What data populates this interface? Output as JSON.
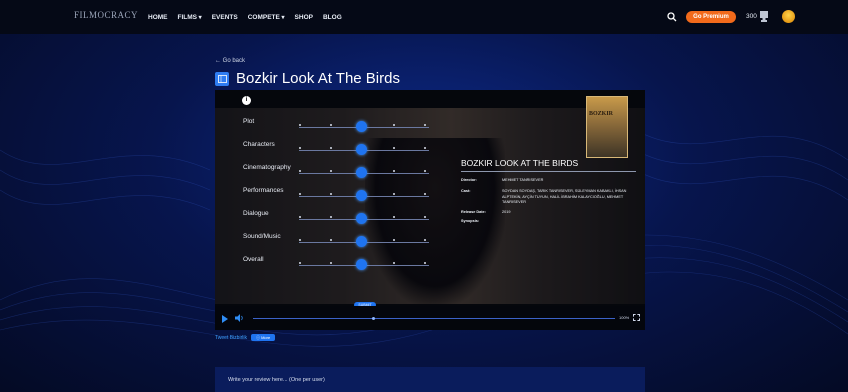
{
  "nav": {
    "logo": "FILMOCRACY",
    "items": [
      {
        "label": "HOME",
        "caret": false
      },
      {
        "label": "FILMS",
        "caret": true
      },
      {
        "label": "EVENTS",
        "caret": false
      },
      {
        "label": "COMPETE",
        "caret": true
      },
      {
        "label": "SHOP",
        "caret": false
      },
      {
        "label": "BLOG",
        "caret": false
      }
    ],
    "premium_label": "Go Premium",
    "coins": "300"
  },
  "header": {
    "back_label": "← Go back",
    "title": "Bozkir Look At The Birds"
  },
  "ratings": {
    "rows": [
      {
        "label": "Plot",
        "value": 3
      },
      {
        "label": "Characters",
        "value": 3
      },
      {
        "label": "Cinematography",
        "value": 3
      },
      {
        "label": "Performances",
        "value": 3
      },
      {
        "label": "Dialogue",
        "value": 3
      },
      {
        "label": "Sound/Music",
        "value": 3
      },
      {
        "label": "Overall",
        "value": 3
      }
    ],
    "scale_max": 5,
    "submit_label": "SUBMIT"
  },
  "film": {
    "poster_text": "BOZKIR",
    "heading": "BOZKIR LOOK AT THE BIRDS",
    "director_key": "Director:",
    "director": "MEHMET TANRISEVER",
    "cast_key": "Cast:",
    "cast": "SOYDAN SOYDAŞ, TARIK TANRISEVER, SÜLEYMAN KABAKLI, İHSAN ALPTEKİN, AYÇİN TUYUN, HALİL İBRAHİM KALAYCIOĞLU, MEHMET TANRISEVER",
    "release_key": "Release Date:",
    "release": "2019",
    "synopsis_key": "Synopsis:",
    "synopsis": ""
  },
  "player": {
    "progress": 0.33,
    "zoom_label": "100%"
  },
  "footer": {
    "tweet_label": "Tweet Bizbirlik",
    "more_label": "ⓘ More",
    "review_placeholder": "Write your review here... (One per user)"
  },
  "colors": {
    "accent": "#1f74f0",
    "premium": "#f26a1b",
    "background": "#07154d"
  }
}
